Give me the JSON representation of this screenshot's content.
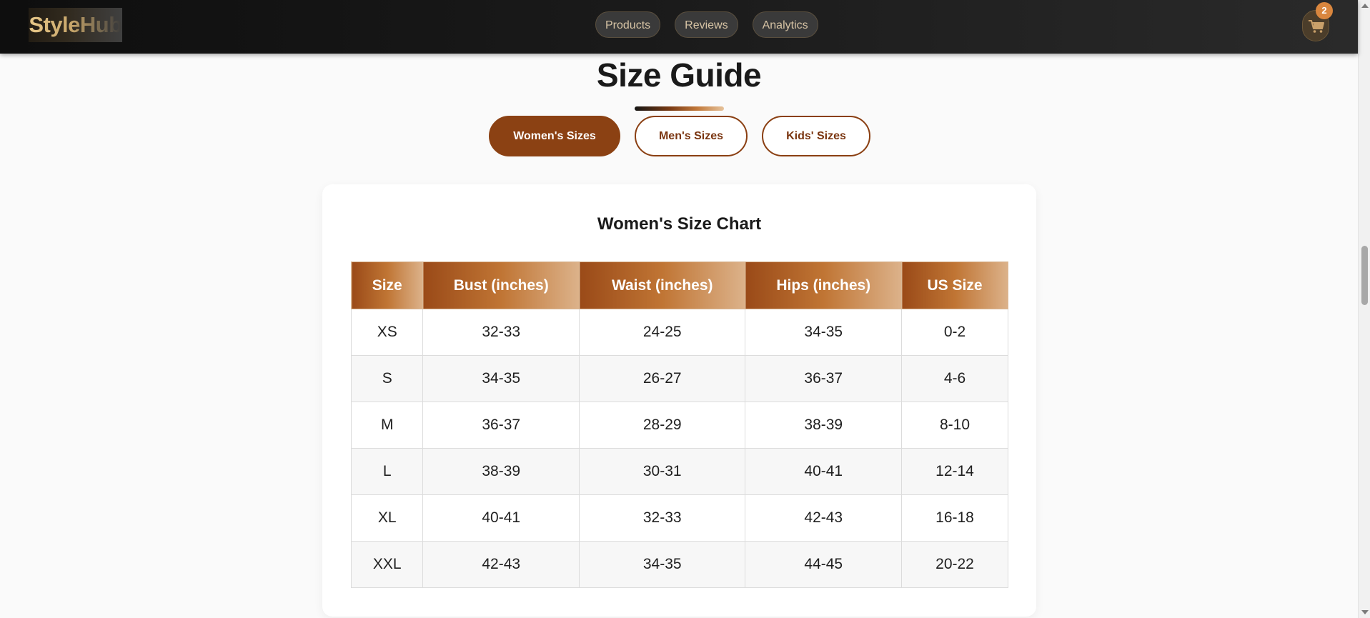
{
  "header": {
    "logo": "StyleHub",
    "nav": [
      "Products",
      "Reviews",
      "Analytics"
    ],
    "cart_count": "2",
    "cart_icon": "shopping-cart-icon"
  },
  "main": {
    "title": "Size Guide",
    "tabs": [
      {
        "label": "Women's Sizes",
        "active": true
      },
      {
        "label": "Men's Sizes",
        "active": false
      },
      {
        "label": "Kids' Sizes",
        "active": false
      }
    ],
    "chart_title": "Women's Size Chart",
    "table": {
      "headers": [
        "Size",
        "Bust (inches)",
        "Waist (inches)",
        "Hips (inches)",
        "US Size"
      ],
      "rows": [
        [
          "XS",
          "32-33",
          "24-25",
          "34-35",
          "0-2"
        ],
        [
          "S",
          "34-35",
          "26-27",
          "36-37",
          "4-6"
        ],
        [
          "M",
          "36-37",
          "28-29",
          "38-39",
          "8-10"
        ],
        [
          "L",
          "38-39",
          "30-31",
          "40-41",
          "12-14"
        ],
        [
          "XL",
          "40-41",
          "32-33",
          "42-43",
          "16-18"
        ],
        [
          "XXL",
          "42-43",
          "34-35",
          "44-45",
          "20-22"
        ]
      ]
    }
  },
  "colors": {
    "accent": "#8b4113",
    "header_bg": "#1b1b1b",
    "badge": "#d9863e"
  }
}
